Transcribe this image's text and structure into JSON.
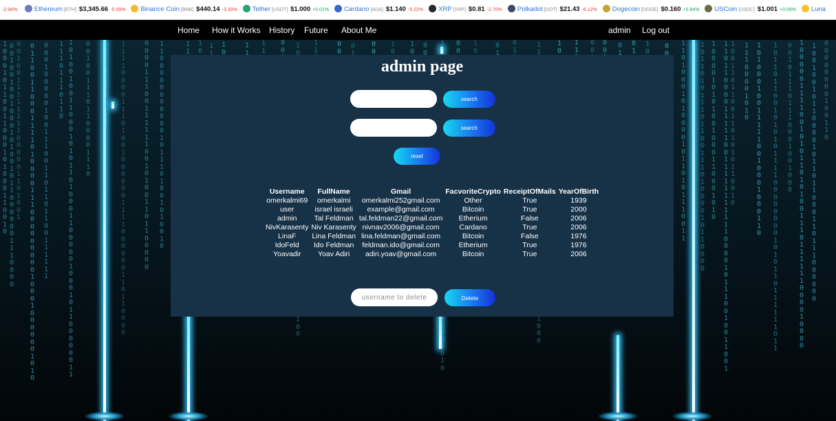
{
  "ticker": {
    "lead_change": "-2.94%",
    "items": [
      {
        "name": "Ethereum",
        "symbol": "[ETH]",
        "price": "$3,345.66",
        "change": "-5.09%",
        "dir": "neg",
        "color": "#6f7cba"
      },
      {
        "name": "Binance Coin",
        "symbol": "[BNB]",
        "price": "$440.14",
        "change": "-3.30%",
        "dir": "neg",
        "color": "#f3ba2f"
      },
      {
        "name": "Tether",
        "symbol": "[USDT]",
        "price": "$1.000",
        "change": "+0.01%",
        "dir": "pos",
        "color": "#26a17b"
      },
      {
        "name": "Cardano",
        "symbol": "[ADA]",
        "price": "$1.140",
        "change": "-5.22%",
        "dir": "neg",
        "color": "#3468d1"
      },
      {
        "name": "XRP",
        "symbol": "[XRP]",
        "price": "$0.81",
        "change": "-2.70%",
        "dir": "neg",
        "color": "#23292f"
      },
      {
        "name": "Polkadot",
        "symbol": "[DOT]",
        "price": "$21.43",
        "change": "-6.12%",
        "dir": "neg",
        "color": "#3b4a6b"
      },
      {
        "name": "Dogecoin",
        "symbol": "[DOGE]",
        "price": "$0.160",
        "change": "+5.94%",
        "dir": "pos",
        "color": "#c2a633"
      },
      {
        "name": "USCoin",
        "symbol": "[USDC]",
        "price": "$1.001",
        "change": "+0.09%",
        "dir": "pos",
        "color": "#6b6b4a"
      },
      {
        "name": "Luna",
        "symbol": "",
        "price": "",
        "change": "",
        "dir": "pos",
        "color": "#f4c430"
      }
    ]
  },
  "nav": {
    "home": "Home",
    "how": "How it Works",
    "history": "History",
    "future": "Future",
    "about": "About Me",
    "user": "admin",
    "logout": "Log out"
  },
  "panel": {
    "title": "admin page",
    "search_label": "search",
    "reset_label": "reset",
    "delete_placeholder": "username to delete",
    "delete_label": "Delete"
  },
  "table": {
    "headers": [
      "Username",
      "FullName",
      "Gmail",
      "FacvoriteCrypto",
      "ReceiptOfMails",
      "YearOfBirth"
    ],
    "rows": [
      [
        "omerkalmi69",
        "omerkalmi",
        "omerkalmi252gmail.com",
        "Other",
        "True",
        "1939"
      ],
      [
        "user",
        "israel israeli",
        "example@gmail.com",
        "Bitcoin",
        "True",
        "2000"
      ],
      [
        "admin",
        "Tal Feldman",
        "tal.feldman22@gmail.com",
        "Etherium",
        "False",
        "2006"
      ],
      [
        "NivKarasenty",
        "Niv Karasenty",
        "nivnav2006@gmail.com",
        "Cardano",
        "True",
        "2006"
      ],
      [
        "LinaF",
        "Lina Feldman",
        "lina.feldman@gmail.com",
        "Bitcoin",
        "False",
        "1976"
      ],
      [
        "IdoFeld",
        "Ido Feldman",
        "feldman.ido@gmail.com",
        "Etherium",
        "True",
        "1976"
      ],
      [
        "Yoavadir",
        "Yoav Adiri",
        "adiri.yoav@gmail.com",
        "Bitcoin",
        "True",
        "2006"
      ]
    ]
  }
}
